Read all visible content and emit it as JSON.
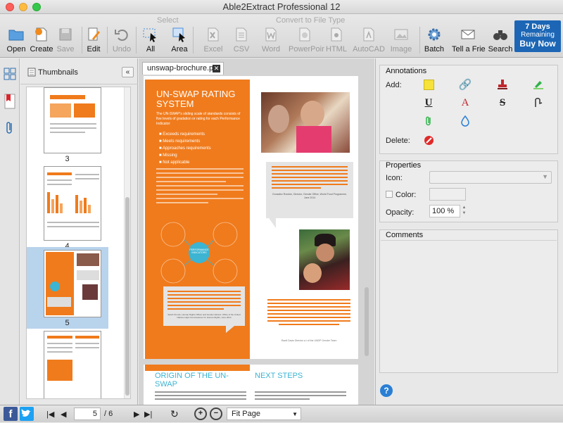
{
  "window": {
    "title": "Able2Extract Professional 12"
  },
  "toolbar": {
    "group_select": "Select",
    "group_convert": "Convert to File Type",
    "open": "Open",
    "create": "Create",
    "save": "Save",
    "edit": "Edit",
    "undo": "Undo",
    "all": "All",
    "area": "Area",
    "excel": "Excel",
    "csv": "CSV",
    "word": "Word",
    "powerpoint": "PowerPoir",
    "html": "HTML",
    "autocad": "AutoCAD",
    "image": "Image",
    "batch": "Batch",
    "tell": "Tell a Frie",
    "search": "Search",
    "buy": {
      "days": "7 Days",
      "remaining": "Remaining",
      "cta": "Buy Now"
    }
  },
  "thumbnails": {
    "title": "Thumbnails",
    "pages": [
      {
        "label": "3"
      },
      {
        "label": "4"
      },
      {
        "label": "5"
      }
    ]
  },
  "document": {
    "tab_label": "unswap-brochure.pdf",
    "left_title": "UN-SWAP RATING SYSTEM",
    "left_intro": "The UN-SWAP's sliding scale of standards consists of five levels of gradation or rating for each Performance Indicator:",
    "ratings": [
      "Exceeds requirements",
      "Meets requirements",
      "Approaches requirements",
      "Missing",
      "Not applicable"
    ],
    "center_node": "PERFORMANCE INDICATORS",
    "quote_left_attr": "Sarah Tomolo, Human Rights Officer and Gender Advisor, Office of the United Nations High Commissioner for Human Rights, June 2014",
    "quote_right_attr": "Gonzalez Rondón, Director, Gender Office, World Food Programme, June 2014",
    "quote_lower_attr": "Rawil Davis Director a.i of the UNDP Gender Team",
    "origin_title": "ORIGIN OF THE UN-SWAP",
    "next_title": "NEXT STEPS"
  },
  "annotations": {
    "title": "Annotations",
    "add_label": "Add:",
    "delete_label": "Delete:"
  },
  "properties": {
    "title": "Properties",
    "icon_label": "Icon:",
    "color_label": "Color:",
    "opacity_label": "Opacity:",
    "opacity_value": "100 %"
  },
  "comments": {
    "title": "Comments"
  },
  "pager": {
    "current": "5",
    "total": "/ 6",
    "zoom": "Fit Page"
  },
  "colors": {
    "accent": "#1c66b5",
    "doc_orange": "#f07b1c",
    "doc_teal": "#3cb4d2"
  }
}
